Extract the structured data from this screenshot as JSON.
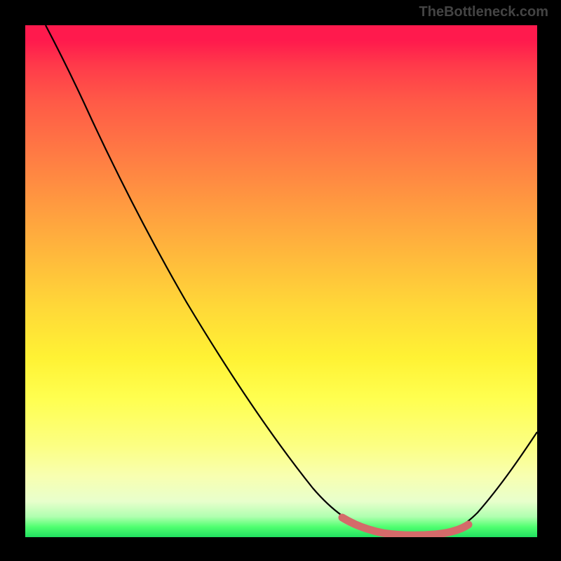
{
  "watermark": "TheBottleneck.com",
  "chart_data": {
    "type": "line",
    "title": "",
    "xlabel": "",
    "ylabel": "",
    "xlim": [
      0,
      100
    ],
    "ylim": [
      0,
      100
    ],
    "series": [
      {
        "name": "curve",
        "color": "#000000",
        "x": [
          4,
          10,
          20,
          30,
          40,
          50,
          58,
          62,
          67,
          72,
          77,
          82,
          85,
          90,
          95,
          100
        ],
        "y": [
          100,
          92,
          79,
          65,
          51,
          37,
          25,
          19,
          12,
          6,
          2.5,
          1.5,
          1.5,
          3,
          8,
          17
        ]
      },
      {
        "name": "highlight",
        "color": "#d86a6a",
        "x": [
          62,
          67,
          72,
          77,
          82,
          85
        ],
        "y": [
          19,
          12,
          6,
          2.5,
          1.5,
          1.5
        ]
      }
    ],
    "gradient_stops": [
      {
        "pos": 0,
        "color": "#ff1a4d"
      },
      {
        "pos": 50,
        "color": "#ffd838"
      },
      {
        "pos": 75,
        "color": "#ffff50"
      },
      {
        "pos": 100,
        "color": "#20e060"
      }
    ]
  }
}
